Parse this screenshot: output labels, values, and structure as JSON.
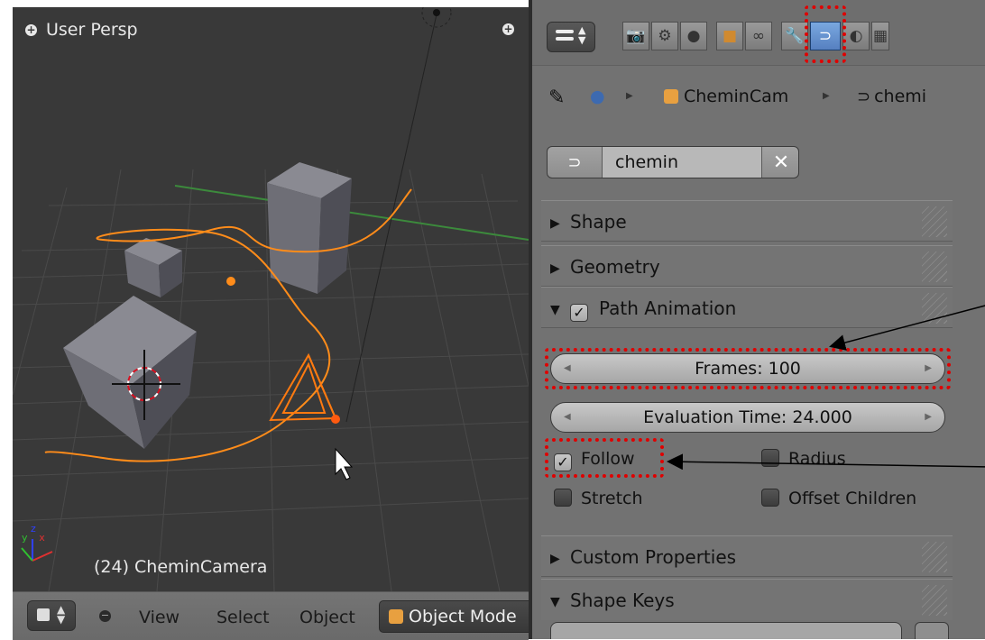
{
  "viewport": {
    "title": "User Persp",
    "status": "(24) CheminCamera",
    "axis_labels": {
      "x": "x",
      "y": "y",
      "z": "z"
    }
  },
  "viewport_header": {
    "menus": [
      "View",
      "Select",
      "Object"
    ],
    "mode": "Object Mode"
  },
  "properties": {
    "tabs": [
      {
        "icon": "camera-icon"
      },
      {
        "icon": "scene-icon"
      },
      {
        "icon": "world-icon"
      },
      {
        "icon": "object-icon"
      },
      {
        "icon": "constraint-icon"
      },
      {
        "icon": "modifier-icon"
      },
      {
        "icon": "curve-data-icon",
        "active": true
      },
      {
        "icon": "material-icon"
      },
      {
        "icon": "texture-icon"
      }
    ],
    "breadcrumb": {
      "object": "CheminCam",
      "data": "chemi"
    },
    "datablock": {
      "name": "chemin"
    },
    "panels": {
      "shape": "Shape",
      "geometry": "Geometry",
      "path_animation": "Path Animation",
      "custom_properties": "Custom Properties",
      "shape_keys": "Shape Keys"
    },
    "frames": {
      "label": "Frames: 100",
      "value": 100
    },
    "evaluation_time": {
      "label": "Evaluation Time: 24.000",
      "value": 24.0
    },
    "options": {
      "follow": {
        "label": "Follow",
        "checked": true
      },
      "radius": {
        "label": "Radius",
        "checked": false
      },
      "stretch": {
        "label": "Stretch",
        "checked": false
      },
      "offset_children": {
        "label": "Offset Children",
        "checked": false
      }
    }
  },
  "colors": {
    "highlight": "#e00000",
    "curve": "#ff8c1a",
    "active_tab": "#5a86c8",
    "viewport_bg": "#393939",
    "panel_bg": "#727272"
  }
}
